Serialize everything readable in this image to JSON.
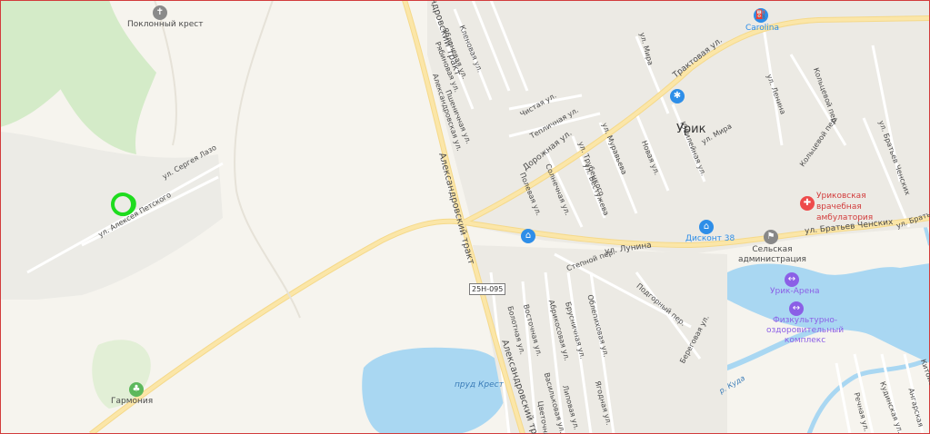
{
  "places": {
    "cross": "Поклонный крест",
    "harmony": "Гармония",
    "carolina": "Carolina",
    "urik": "Урик",
    "hospital": "Уриковская\nврачебная\nамбулатория",
    "discount": "Дисконт 38",
    "admin": "Сельская\nадминистрация",
    "arena": "Урик-Арена",
    "sport": "Физкультурно-\nоздоровительный\nкомплекс",
    "pond": "пруд Крест",
    "river": "р. Куда"
  },
  "roads": {
    "lazo": "ул. Сергея Лазо",
    "alexey": "ул. Алексея Петского",
    "trakt_main": "Александровский тракт",
    "trakt_top": "Александровский тракт",
    "trakt_bottom": "Александровский тракт",
    "badge": "25Н-095",
    "klenovaya": "Кленовая ул.",
    "yablonevaya": "Яблоневая ул.",
    "ryabinovaya": "Рябиновая ул.",
    "pshenichnaya": "Пшеничная ул.",
    "alexandrovskaya": "Александровская ул.",
    "chistaya": "Чистая ул.",
    "teplichnaya": "Тепличная ул.",
    "dorozhnaya": "Дорожная ул.",
    "traktovaya": "Трактовая ул.",
    "mira_top": "ул. Мира",
    "mira": "ул. Мира",
    "lenina": "ул. Ленина",
    "kolceva": "Кольцевой пер.",
    "kolceva2": "Кольцевой пер.",
    "bratiev": "ул. Братьев Ченских",
    "bratiev2": "ул. Братьев Ченских",
    "bratiev3": "ул. Братье",
    "muravieva": "ул. Муравьева",
    "trubetskogo": "ул. Трубецкого",
    "bestuzheva": "ул. Бестужева",
    "novaya": "Новая ул.",
    "yubileynaya": "Юбилейная ул.",
    "solnechnaya": "Солнечная ул.",
    "polevaya": "Полевая ул.",
    "lunina": "ул. Лунина",
    "stepnoy": "Степной пер.",
    "podgorny": "Подгорный пер.",
    "beregovaya": "Береговая ул.",
    "bolotnaya": "Болотная ул.",
    "vostochnaya": "Восточная ул.",
    "abrikosovaya": "Абрикосовая ул.",
    "brusnichnaya": "Брусничная ул.",
    "oblepikhovaya": "Облепиховая ул.",
    "yagodnaya": "Ягодная ул.",
    "vasilkovaya": "Васильковая ул.",
    "lipovaya": "Липовая ул.",
    "tsvetochnaya": "Цветочная",
    "rechnaya": "Речная ул.",
    "kudinskaya": "Кудинская ул.",
    "angarskaya": "Ангарская",
    "kitoyskaya": "Китойская ул."
  },
  "colors": {
    "background": "#f6f4ee",
    "forest": "#d4ebc8",
    "water": "#a9d7f2",
    "road": "#fbe6a8",
    "marker": "#1edc1e",
    "poi_blue": "#2e8ee8",
    "poi_red": "#ee4b4b",
    "poi_purple": "#8b5fe6",
    "poi_green": "#5cb85c",
    "poi_gray": "#888888"
  },
  "icons": {
    "cross": "cross-icon",
    "harmony": "park-icon",
    "carolina": "fuel-icon",
    "paw": "paw-icon",
    "hospital": "hospital-icon",
    "shop1": "basket-icon",
    "shop2": "basket-icon",
    "admin": "flag-icon",
    "arena": "sport-icon",
    "sport": "sport-icon"
  }
}
